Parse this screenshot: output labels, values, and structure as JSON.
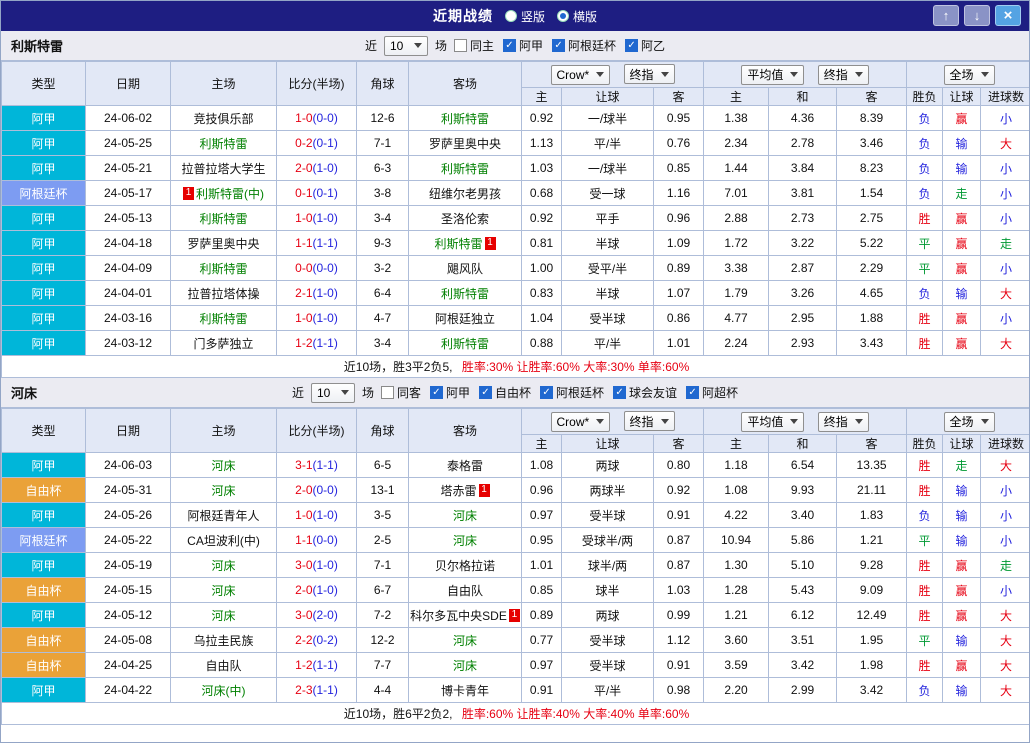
{
  "header": {
    "title": "近期战绩",
    "radios": [
      {
        "label": "竖版",
        "selected": false
      },
      {
        "label": "横版",
        "selected": true
      }
    ],
    "up_icon": "↑",
    "down_icon": "↓",
    "close_icon": "×"
  },
  "controls": {
    "book": "Crow*",
    "stage": "终指",
    "average": "平均值",
    "stage2": "终指",
    "scope": "全场"
  },
  "table_header": {
    "main": [
      "类型",
      "日期",
      "主场",
      "比分(半场)",
      "角球",
      "客场"
    ],
    "sub": [
      "主",
      "让球",
      "客",
      "主",
      "和",
      "客",
      "胜负",
      "让球",
      "进球数"
    ]
  },
  "league_colors": {
    "阿甲": "#00b6d9",
    "阿根廷杯": "#7d9cf2",
    "自由杯": "#eaa238"
  },
  "result_colors": {
    "胜": "#e60012",
    "赢": "#e60012",
    "大": "#e60012",
    "平": "#009933",
    "走": "#009933",
    "负": "#2424dd",
    "输": "#2424dd",
    "小": "#2424dd"
  },
  "colors": {
    "titlebar_bg": "#1e1e82",
    "section_bar_bg": "#ebebf2",
    "head_bg": "#e2e8f6",
    "grid_border": "#aebdd9",
    "score_red": "#e60012",
    "half_blue": "#2424dd",
    "focus_green": "#008000",
    "check_blue": "#2068d0",
    "arrow_btn_bg": "#8a93c6",
    "close_btn_bg": "#54a3e3",
    "summary_red": "#e60012",
    "red_badge": "#e60000"
  },
  "sections": [
    {
      "team": "利斯特雷",
      "filter": {
        "near_label": "近",
        "count": "10",
        "games_label": "场",
        "checkboxes": [
          {
            "label": "同主",
            "checked": false
          },
          {
            "label": "阿甲",
            "checked": true
          },
          {
            "label": "阿根廷杯",
            "checked": true
          },
          {
            "label": "阿乙",
            "checked": true
          }
        ]
      },
      "rows": [
        {
          "league": "阿甲",
          "date": "24-06-02",
          "home": {
            "name": "竞技俱乐部"
          },
          "away": {
            "name": "利斯特雷",
            "focus": true
          },
          "score": "1-0",
          "half": "(0-0)",
          "corners": "12-6",
          "odds": [
            "0.92",
            "一/球半",
            "0.95"
          ],
          "avg": [
            "1.38",
            "4.36",
            "8.39"
          ],
          "result": [
            "负",
            "赢",
            "小"
          ]
        },
        {
          "league": "阿甲",
          "date": "24-05-25",
          "home": {
            "name": "利斯特雷",
            "focus": true
          },
          "away": {
            "name": "罗萨里奥中央"
          },
          "score": "0-2",
          "half": "(0-1)",
          "corners": "7-1",
          "odds": [
            "1.13",
            "平/半",
            "0.76"
          ],
          "avg": [
            "2.34",
            "2.78",
            "3.46"
          ],
          "result": [
            "负",
            "输",
            "大"
          ]
        },
        {
          "league": "阿甲",
          "date": "24-05-21",
          "home": {
            "name": "拉普拉塔大学生"
          },
          "away": {
            "name": "利斯特雷",
            "focus": true
          },
          "score": "2-0",
          "half": "(1-0)",
          "corners": "6-3",
          "odds": [
            "1.03",
            "一/球半",
            "0.85"
          ],
          "avg": [
            "1.44",
            "3.84",
            "8.23"
          ],
          "result": [
            "负",
            "输",
            "小"
          ]
        },
        {
          "league": "阿根廷杯",
          "date": "24-05-17",
          "home": {
            "name": "利斯特雷(中)",
            "focus": true,
            "badge": "1",
            "badge_side": "left"
          },
          "away": {
            "name": "纽维尔老男孩"
          },
          "score": "0-1",
          "half": "(0-1)",
          "corners": "3-8",
          "odds": [
            "0.68",
            "受一球",
            "1.16"
          ],
          "avg": [
            "7.01",
            "3.81",
            "1.54"
          ],
          "result": [
            "负",
            "走",
            "小"
          ]
        },
        {
          "league": "阿甲",
          "date": "24-05-13",
          "home": {
            "name": "利斯特雷",
            "focus": true
          },
          "away": {
            "name": "圣洛伦索"
          },
          "score": "1-0",
          "half": "(1-0)",
          "corners": "3-4",
          "odds": [
            "0.92",
            "平手",
            "0.96"
          ],
          "avg": [
            "2.88",
            "2.73",
            "2.75"
          ],
          "result": [
            "胜",
            "赢",
            "小"
          ]
        },
        {
          "league": "阿甲",
          "date": "24-04-18",
          "home": {
            "name": "罗萨里奥中央"
          },
          "away": {
            "name": "利斯特雷",
            "focus": true,
            "badge": "1",
            "badge_side": "right"
          },
          "score": "1-1",
          "half": "(1-1)",
          "corners": "9-3",
          "odds": [
            "0.81",
            "半球",
            "1.09"
          ],
          "avg": [
            "1.72",
            "3.22",
            "5.22"
          ],
          "result": [
            "平",
            "赢",
            "走"
          ]
        },
        {
          "league": "阿甲",
          "date": "24-04-09",
          "home": {
            "name": "利斯特雷",
            "focus": true
          },
          "away": {
            "name": "飓风队"
          },
          "score": "0-0",
          "half": "(0-0)",
          "corners": "3-2",
          "odds": [
            "1.00",
            "受平/半",
            "0.89"
          ],
          "avg": [
            "3.38",
            "2.87",
            "2.29"
          ],
          "result": [
            "平",
            "赢",
            "小"
          ]
        },
        {
          "league": "阿甲",
          "date": "24-04-01",
          "home": {
            "name": "拉普拉塔体操"
          },
          "away": {
            "name": "利斯特雷",
            "focus": true
          },
          "score": "2-1",
          "half": "(1-0)",
          "corners": "6-4",
          "odds": [
            "0.83",
            "半球",
            "1.07"
          ],
          "avg": [
            "1.79",
            "3.26",
            "4.65"
          ],
          "result": [
            "负",
            "输",
            "大"
          ]
        },
        {
          "league": "阿甲",
          "date": "24-03-16",
          "home": {
            "name": "利斯特雷",
            "focus": true
          },
          "away": {
            "name": "阿根廷独立"
          },
          "score": "1-0",
          "half": "(1-0)",
          "corners": "4-7",
          "odds": [
            "1.04",
            "受半球",
            "0.86"
          ],
          "avg": [
            "4.77",
            "2.95",
            "1.88"
          ],
          "result": [
            "胜",
            "赢",
            "小"
          ]
        },
        {
          "league": "阿甲",
          "date": "24-03-12",
          "home": {
            "name": "门多萨独立"
          },
          "away": {
            "name": "利斯特雷",
            "focus": true
          },
          "score": "1-2",
          "half": "(1-1)",
          "corners": "3-4",
          "odds": [
            "0.88",
            "平/半",
            "1.01"
          ],
          "avg": [
            "2.24",
            "2.93",
            "3.43"
          ],
          "result": [
            "胜",
            "赢",
            "大"
          ]
        }
      ],
      "summary": {
        "record": "近10场，胜3平2负5,",
        "rates": "胜率:30% 让胜率:60% 大率:30% 单率:60%"
      }
    },
    {
      "team": "河床",
      "filter": {
        "near_label": "近",
        "count": "10",
        "games_label": "场",
        "checkboxes": [
          {
            "label": "同客",
            "checked": false
          },
          {
            "label": "阿甲",
            "checked": true
          },
          {
            "label": "自由杯",
            "checked": true
          },
          {
            "label": "阿根廷杯",
            "checked": true
          },
          {
            "label": "球会友谊",
            "checked": true
          },
          {
            "label": "阿超杯",
            "checked": true
          }
        ]
      },
      "rows": [
        {
          "league": "阿甲",
          "date": "24-06-03",
          "home": {
            "name": "河床",
            "focus": true
          },
          "away": {
            "name": "泰格雷"
          },
          "score": "3-1",
          "half": "(1-1)",
          "corners": "6-5",
          "odds": [
            "1.08",
            "两球",
            "0.80"
          ],
          "avg": [
            "1.18",
            "6.54",
            "13.35"
          ],
          "result": [
            "胜",
            "走",
            "大"
          ]
        },
        {
          "league": "自由杯",
          "date": "24-05-31",
          "home": {
            "name": "河床",
            "focus": true
          },
          "away": {
            "name": "塔赤雷",
            "badge": "1",
            "badge_side": "right"
          },
          "score": "2-0",
          "half": "(0-0)",
          "corners": "13-1",
          "odds": [
            "0.96",
            "两球半",
            "0.92"
          ],
          "avg": [
            "1.08",
            "9.93",
            "21.11"
          ],
          "result": [
            "胜",
            "输",
            "小"
          ]
        },
        {
          "league": "阿甲",
          "date": "24-05-26",
          "home": {
            "name": "阿根廷青年人"
          },
          "away": {
            "name": "河床",
            "focus": true
          },
          "score": "1-0",
          "half": "(1-0)",
          "corners": "3-5",
          "odds": [
            "0.97",
            "受半球",
            "0.91"
          ],
          "avg": [
            "4.22",
            "3.40",
            "1.83"
          ],
          "result": [
            "负",
            "输",
            "小"
          ]
        },
        {
          "league": "阿根廷杯",
          "date": "24-05-22",
          "home": {
            "name": "CA坦波利(中)"
          },
          "away": {
            "name": "河床",
            "focus": true
          },
          "score": "1-1",
          "half": "(0-0)",
          "corners": "2-5",
          "odds": [
            "0.95",
            "受球半/两",
            "0.87"
          ],
          "avg": [
            "10.94",
            "5.86",
            "1.21"
          ],
          "result": [
            "平",
            "输",
            "小"
          ]
        },
        {
          "league": "阿甲",
          "date": "24-05-19",
          "home": {
            "name": "河床",
            "focus": true
          },
          "away": {
            "name": "贝尔格拉诺"
          },
          "score": "3-0",
          "half": "(1-0)",
          "corners": "7-1",
          "odds": [
            "1.01",
            "球半/两",
            "0.87"
          ],
          "avg": [
            "1.30",
            "5.10",
            "9.28"
          ],
          "result": [
            "胜",
            "赢",
            "走"
          ]
        },
        {
          "league": "自由杯",
          "date": "24-05-15",
          "home": {
            "name": "河床",
            "focus": true
          },
          "away": {
            "name": "自由队"
          },
          "score": "2-0",
          "half": "(1-0)",
          "corners": "6-7",
          "odds": [
            "0.85",
            "球半",
            "1.03"
          ],
          "avg": [
            "1.28",
            "5.43",
            "9.09"
          ],
          "result": [
            "胜",
            "赢",
            "小"
          ]
        },
        {
          "league": "阿甲",
          "date": "24-05-12",
          "home": {
            "name": "河床",
            "focus": true
          },
          "away": {
            "name": "科尔多瓦中央SDE",
            "badge": "1",
            "badge_side": "right"
          },
          "score": "3-0",
          "half": "(2-0)",
          "corners": "7-2",
          "odds": [
            "0.89",
            "两球",
            "0.99"
          ],
          "avg": [
            "1.21",
            "6.12",
            "12.49"
          ],
          "result": [
            "胜",
            "赢",
            "大"
          ]
        },
        {
          "league": "自由杯",
          "date": "24-05-08",
          "home": {
            "name": "乌拉圭民族"
          },
          "away": {
            "name": "河床",
            "focus": true
          },
          "score": "2-2",
          "half": "(0-2)",
          "corners": "12-2",
          "odds": [
            "0.77",
            "受半球",
            "1.12"
          ],
          "avg": [
            "3.60",
            "3.51",
            "1.95"
          ],
          "result": [
            "平",
            "输",
            "大"
          ]
        },
        {
          "league": "自由杯",
          "date": "24-04-25",
          "home": {
            "name": "自由队"
          },
          "away": {
            "name": "河床",
            "focus": true
          },
          "score": "1-2",
          "half": "(1-1)",
          "corners": "7-7",
          "odds": [
            "0.97",
            "受半球",
            "0.91"
          ],
          "avg": [
            "3.59",
            "3.42",
            "1.98"
          ],
          "result": [
            "胜",
            "赢",
            "大"
          ]
        },
        {
          "league": "阿甲",
          "date": "24-04-22",
          "home": {
            "name": "河床(中)",
            "focus": true
          },
          "away": {
            "name": "博卡青年"
          },
          "score": "2-3",
          "half": "(1-1)",
          "corners": "4-4",
          "odds": [
            "0.91",
            "平/半",
            "0.98"
          ],
          "avg": [
            "2.20",
            "2.99",
            "3.42"
          ],
          "result": [
            "负",
            "输",
            "大"
          ]
        }
      ],
      "summary": {
        "record": "近10场，胜6平2负2,",
        "rates": "胜率:60% 让胜率:40% 大率:40% 单率:60%"
      }
    }
  ]
}
